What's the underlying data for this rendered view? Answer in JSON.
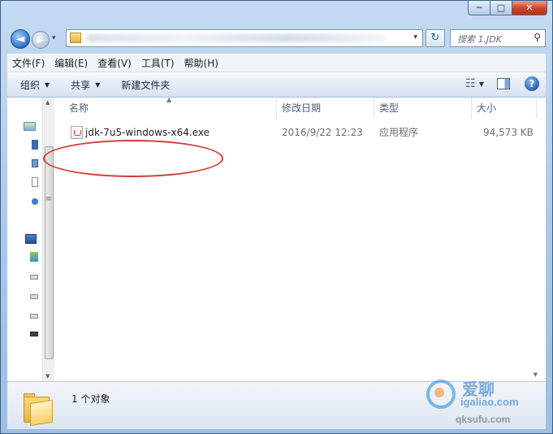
{
  "window": {
    "caption": {
      "minimize": "─",
      "maximize": "□",
      "close": "✕"
    }
  },
  "nav": {
    "back": "◄",
    "forward": "►",
    "history_dropdown": "▾",
    "address_dropdown": "▾",
    "refresh": "↻",
    "search_placeholder": "搜索 1.JDK",
    "search_icon": "⚲"
  },
  "menubar": {
    "items": [
      "文件(F)",
      "编辑(E)",
      "查看(V)",
      "工具(T)",
      "帮助(H)"
    ]
  },
  "commandbar": {
    "organize": "组织",
    "share": "共享",
    "new_folder": "新建文件夹",
    "dropdown_arrow": "▼",
    "view_icon": "☷",
    "view_arrow": "▼",
    "help": "?"
  },
  "columns": {
    "name": "名称",
    "modified": "修改日期",
    "type": "类型",
    "size": "大小",
    "sort_caret": "▲"
  },
  "files": [
    {
      "name": "jdk-7u5-windows-x64.exe",
      "modified": "2016/9/22 12:23",
      "type": "应用程序",
      "size": "94,573 KB"
    }
  ],
  "statusbar": {
    "count": "1 个对象"
  },
  "scroll": {
    "up": "▲",
    "down": "▼",
    "grip": "≡"
  },
  "watermark": {
    "brand_cn": "爱聊",
    "site": "igaliao.com",
    "site2": "qksufu.com"
  },
  "colors": {
    "highlight_ring": "#d23a32",
    "accent": "#2a71c7"
  }
}
